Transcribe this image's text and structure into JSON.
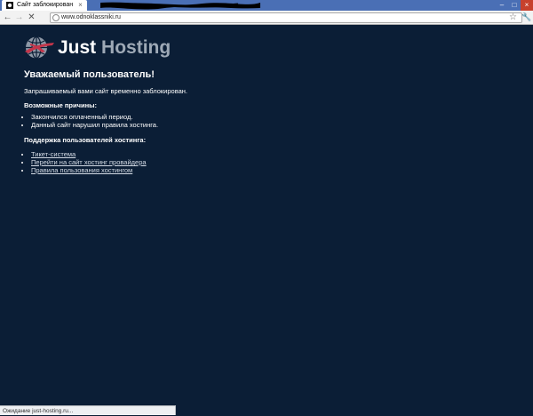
{
  "browser": {
    "tab": {
      "title": "Сайт заблокирован",
      "close_glyph": "×",
      "favicon": "dark-logo-icon"
    },
    "nav": {
      "back_glyph": "←",
      "forward_glyph": "→",
      "stop_glyph": "✕"
    },
    "url": "www.odnoklassniki.ru",
    "bookmark_glyph": "☆",
    "menu_glyph": "🔧",
    "window_controls": {
      "minimize": "–",
      "maximize": "□",
      "close": "×"
    },
    "colors": {
      "tabstrip": "#4a6fb5",
      "toolbar": "#f2f2f2",
      "close": "#c7412d"
    }
  },
  "page": {
    "logo": {
      "word1": "Just",
      "word2": "Hosting",
      "icon": "globe-logo-icon"
    },
    "greeting": "Уважаемый пользователь!",
    "message": "Запрашиваемый вами сайт временно заблокирован.",
    "reasons_title": "Возможные причины:",
    "reasons": [
      "Закончился оплаченный период.",
      "Данный сайт нарушил правила хостинга."
    ],
    "support_title": "Поддержка пользователей хостинга:",
    "support_links": [
      "Тикет-система",
      "Перейти на сайт хостинг провайдера",
      "Правила пользования хостингом"
    ],
    "colors": {
      "background": "#0b1e36",
      "text": "#ffffff",
      "logo_accent": "#c4354a",
      "logo_secondary": "#9ea9b6"
    }
  },
  "status_bar": {
    "text": "Ожидание just-hosting.ru..."
  }
}
